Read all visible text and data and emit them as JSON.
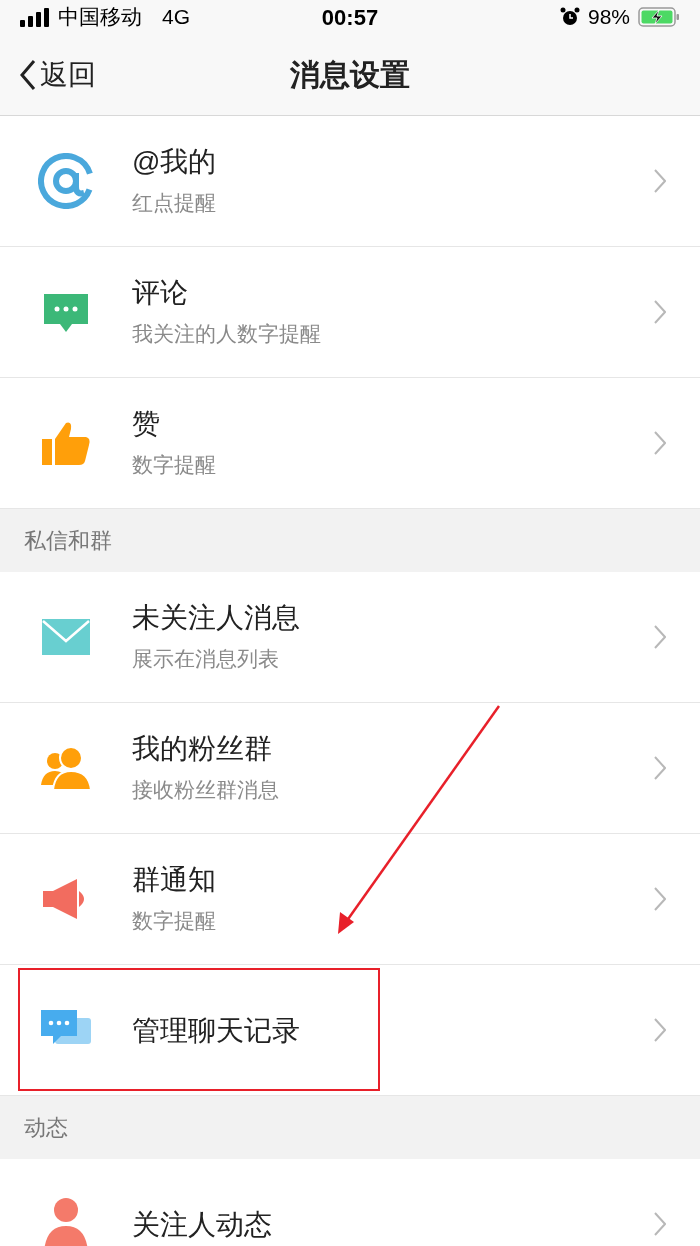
{
  "status_bar": {
    "carrier": "中国移动",
    "network": "4G",
    "time": "00:57",
    "battery": "98%"
  },
  "nav": {
    "back": "返回",
    "title": "消息设置"
  },
  "sections": [
    {
      "items": [
        {
          "kind": "at",
          "title": "@我的",
          "subtitle": "红点提醒",
          "highlighted": false
        },
        {
          "kind": "comment",
          "title": "评论",
          "subtitle": "我关注的人数字提醒",
          "highlighted": false
        },
        {
          "kind": "thumb",
          "title": "赞",
          "subtitle": "数字提醒",
          "highlighted": false
        }
      ]
    },
    {
      "header": "私信和群",
      "items": [
        {
          "kind": "mail",
          "title": "未关注人消息",
          "subtitle": "展示在消息列表",
          "highlighted": false
        },
        {
          "kind": "group",
          "title": "我的粉丝群",
          "subtitle": "接收粉丝群消息",
          "highlighted": false
        },
        {
          "kind": "megaphone",
          "title": "群通知",
          "subtitle": "数字提醒",
          "highlighted": false
        },
        {
          "kind": "chat",
          "title": "管理聊天记录",
          "highlighted": true
        }
      ]
    },
    {
      "header": "动态",
      "items": [
        {
          "kind": "person",
          "title": "关注人动态",
          "highlighted": false
        }
      ]
    }
  ]
}
